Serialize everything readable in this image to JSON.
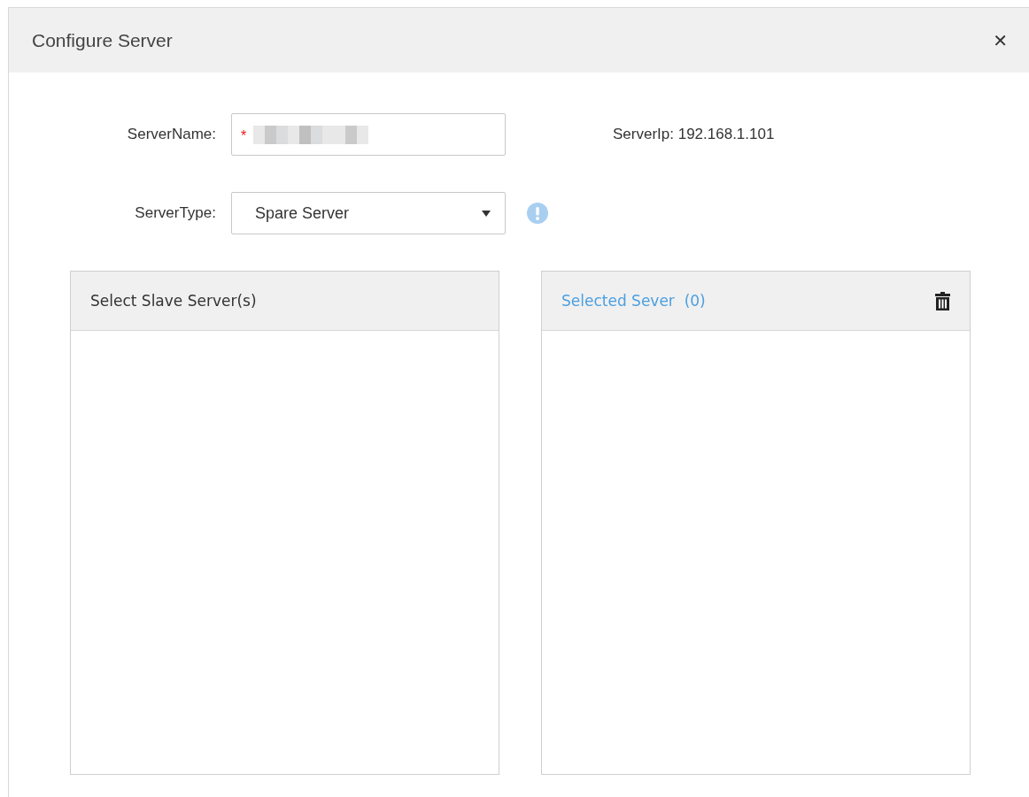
{
  "dialog": {
    "title": "Configure Server",
    "close_label": "✕"
  },
  "form": {
    "server_name": {
      "label": "ServerName:",
      "required_mark": "*"
    },
    "server_ip": "ServerIp: 192.168.1.101",
    "server_type": {
      "label": "ServerType:",
      "value": "Spare Server"
    }
  },
  "panels": [
    {
      "kind": "source",
      "title": "Select Slave Server(s)"
    },
    {
      "kind": "selected",
      "title": "Selected Sever  (0)"
    }
  ]
}
